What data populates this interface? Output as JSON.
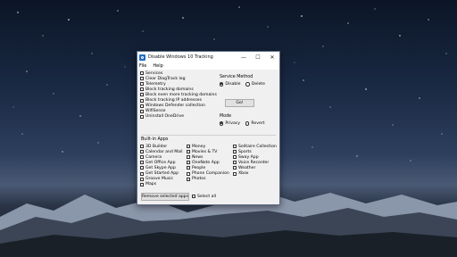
{
  "window": {
    "title": "Disable Windows 10 Tracking"
  },
  "menu": [
    "File",
    "Help"
  ],
  "options": [
    "Services",
    "Clear DiagTrack log",
    "Telemetry",
    "Block tracking domains",
    "Block even more tracking domains",
    "Block tracking IP addresses",
    "Windows Defender collection",
    "WifiSense",
    "Uninstall OneDrive"
  ],
  "service_method": {
    "label": "Service Method",
    "options": [
      "Disable",
      "Delete"
    ],
    "selected": "Disable"
  },
  "go_button": "Go!",
  "mode": {
    "label": "Mode",
    "options": [
      "Privacy",
      "Revert"
    ],
    "selected": "Privacy"
  },
  "builtin": {
    "label": "Built-in Apps",
    "col1": [
      "3D Builder",
      "Calendar and Mail",
      "Camera",
      "Get Office App",
      "Get Skype App",
      "Get Started App",
      "Groove Music",
      "Maps"
    ],
    "col2": [
      "Money",
      "Movies & TV",
      "News",
      "OneNote App",
      "People",
      "Phone Companion",
      "Photos"
    ],
    "col3": [
      "Solitaire Collection",
      "Sports",
      "Sway App",
      "Voice Recorder",
      "Weather",
      "Xbox"
    ]
  },
  "remove_button": "Remove selected apps",
  "select_all": "Select all"
}
